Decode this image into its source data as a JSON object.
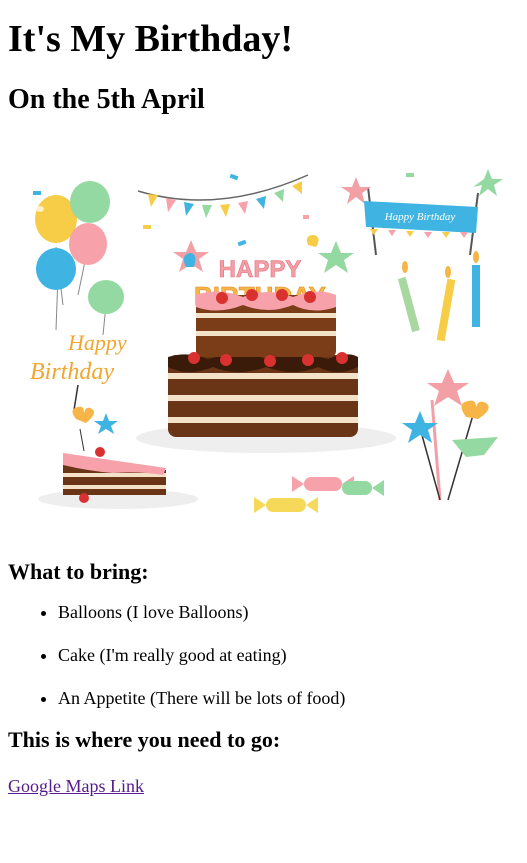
{
  "header": {
    "title": "It's My Birthday!",
    "date": "On the 5th April"
  },
  "hero": {
    "banner_small_text": "Happy Birthday",
    "cake_topper_line1": "HAPPY",
    "cake_topper_line2": "BIRTHDAY",
    "script_text_line1": "Happy",
    "script_text_line2": "Birthday"
  },
  "bring": {
    "heading": "What to bring:",
    "items": [
      "Balloons (I love Balloons)",
      "Cake (I'm really good at eating)",
      "An Appetite (There will be lots of food)"
    ]
  },
  "location": {
    "heading": "This is where you need to go:",
    "link_text": "Google Maps Link"
  },
  "colors": {
    "link_visited": "#551a8b",
    "text": "#000000"
  }
}
